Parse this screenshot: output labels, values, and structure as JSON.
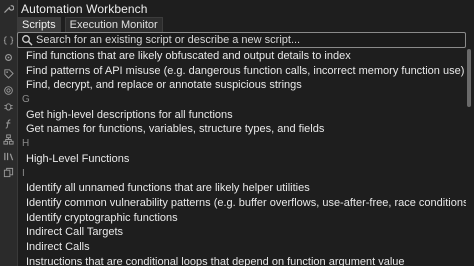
{
  "app": {
    "title": "Automation Workbench"
  },
  "tabs": [
    {
      "label": "Scripts",
      "active": true
    },
    {
      "label": "Execution Monitor",
      "active": false
    }
  ],
  "search": {
    "placeholder": "Search for an existing script or describe a new script...",
    "value": ""
  },
  "sidebar_icons": [
    "wrench-icon",
    "code-braces-icon",
    "gear-icon",
    "tag-icon",
    "target-icon",
    "bug-icon",
    "function-icon",
    "hierarchy-icon",
    "library-icon",
    "copy-icon"
  ],
  "list": [
    {
      "type": "item",
      "text": "Find functions that are likely obfuscated and output details to index"
    },
    {
      "type": "item",
      "text": "Find patterns of API misuse (e.g. dangerous function calls, incorrect memory function use)"
    },
    {
      "type": "item",
      "text": "Find, decrypt, and replace or annotate suspicious strings"
    },
    {
      "type": "header",
      "text": "G"
    },
    {
      "type": "item",
      "text": "Get high-level descriptions for all functions"
    },
    {
      "type": "item",
      "text": "Get names for functions, variables, structure types, and fields"
    },
    {
      "type": "header",
      "text": "H"
    },
    {
      "type": "item",
      "text": "High-Level Functions"
    },
    {
      "type": "header",
      "text": "I"
    },
    {
      "type": "item",
      "text": "Identify all unnamed functions that are likely helper utilities"
    },
    {
      "type": "item",
      "text": "Identify common vulnerability patterns (e.g. buffer overflows, use-after-free, race conditions)"
    },
    {
      "type": "item",
      "text": "Identify cryptographic functions"
    },
    {
      "type": "item",
      "text": "Indirect Call Targets"
    },
    {
      "type": "item",
      "text": "Indirect Calls"
    },
    {
      "type": "item",
      "text": "Instructions that are conditional loops that depend on function argument value"
    }
  ],
  "colors": {
    "background": "#1e1e1e",
    "sidebar": "#2b2b2b",
    "search_border": "#8a8a8a",
    "header_text": "#8b8b8b"
  }
}
